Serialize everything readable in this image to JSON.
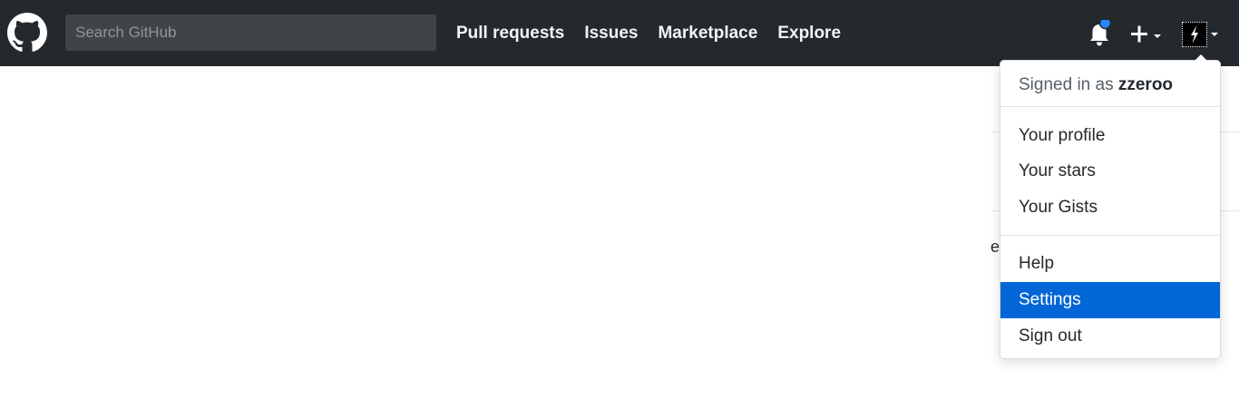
{
  "header": {
    "search_placeholder": "Search GitHub",
    "nav_items": [
      {
        "label": "Pull requests"
      },
      {
        "label": "Issues"
      },
      {
        "label": "Marketplace"
      },
      {
        "label": "Explore"
      }
    ],
    "notification_unread": true,
    "icons": [
      "github-logo-icon",
      "bell-icon",
      "plus-icon",
      "chevron-down-icon",
      "avatar"
    ]
  },
  "background_fragment_text": "ea",
  "user_menu": {
    "signed_in_prefix": "Signed in as",
    "username": "zzeroo",
    "items": [
      {
        "label": "Your profile",
        "active": false
      },
      {
        "label": "Your stars",
        "active": false
      },
      {
        "label": "Your Gists",
        "active": false
      },
      {
        "label": "Help",
        "active": false
      },
      {
        "label": "Settings",
        "active": true
      },
      {
        "label": "Sign out",
        "active": false
      }
    ]
  },
  "colors": {
    "header_bg": "#24292e",
    "accent": "#0366d6",
    "notification_dot": "#2188ff"
  }
}
